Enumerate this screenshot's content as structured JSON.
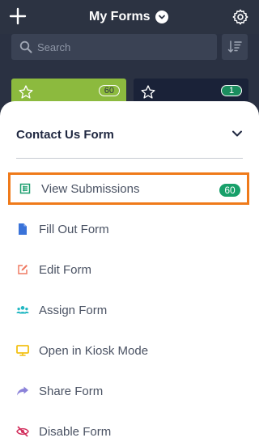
{
  "header": {
    "title": "My Forms",
    "add_icon": "plus-icon",
    "settings_icon": "gear-icon",
    "title_dropdown_icon": "chevron-down-icon"
  },
  "search": {
    "placeholder": "Search",
    "value": "",
    "icon": "search-icon",
    "sort_icon": "sort-icon"
  },
  "cards": [
    {
      "count": "60",
      "color": "#8cba3e",
      "starred": false
    },
    {
      "count": "1",
      "color": "#1a2238",
      "starred": false
    }
  ],
  "sheet": {
    "title": "Contact Us Form",
    "collapse_icon": "chevron-down-icon",
    "items": [
      {
        "label": "View Submissions",
        "icon": "submissions-icon",
        "icon_color": "#1a9e6e",
        "count": "60",
        "highlighted": true
      },
      {
        "label": "Fill Out Form",
        "icon": "document-icon",
        "icon_color": "#3a73d9"
      },
      {
        "label": "Edit Form",
        "icon": "edit-icon",
        "icon_color": "#ef7b63"
      },
      {
        "label": "Assign Form",
        "icon": "users-icon",
        "icon_color": "#22b7c2"
      },
      {
        "label": "Open in Kiosk Mode",
        "icon": "monitor-icon",
        "icon_color": "#f3c114"
      },
      {
        "label": "Share Form",
        "icon": "share-icon",
        "icon_color": "#8b82d9"
      },
      {
        "label": "Disable Form",
        "icon": "disable-icon",
        "icon_color": "#d3325f"
      }
    ]
  },
  "colors": {
    "header_bg": "#2c3342",
    "highlight_border": "#ef7a1a",
    "badge_green": "#18a06a"
  }
}
